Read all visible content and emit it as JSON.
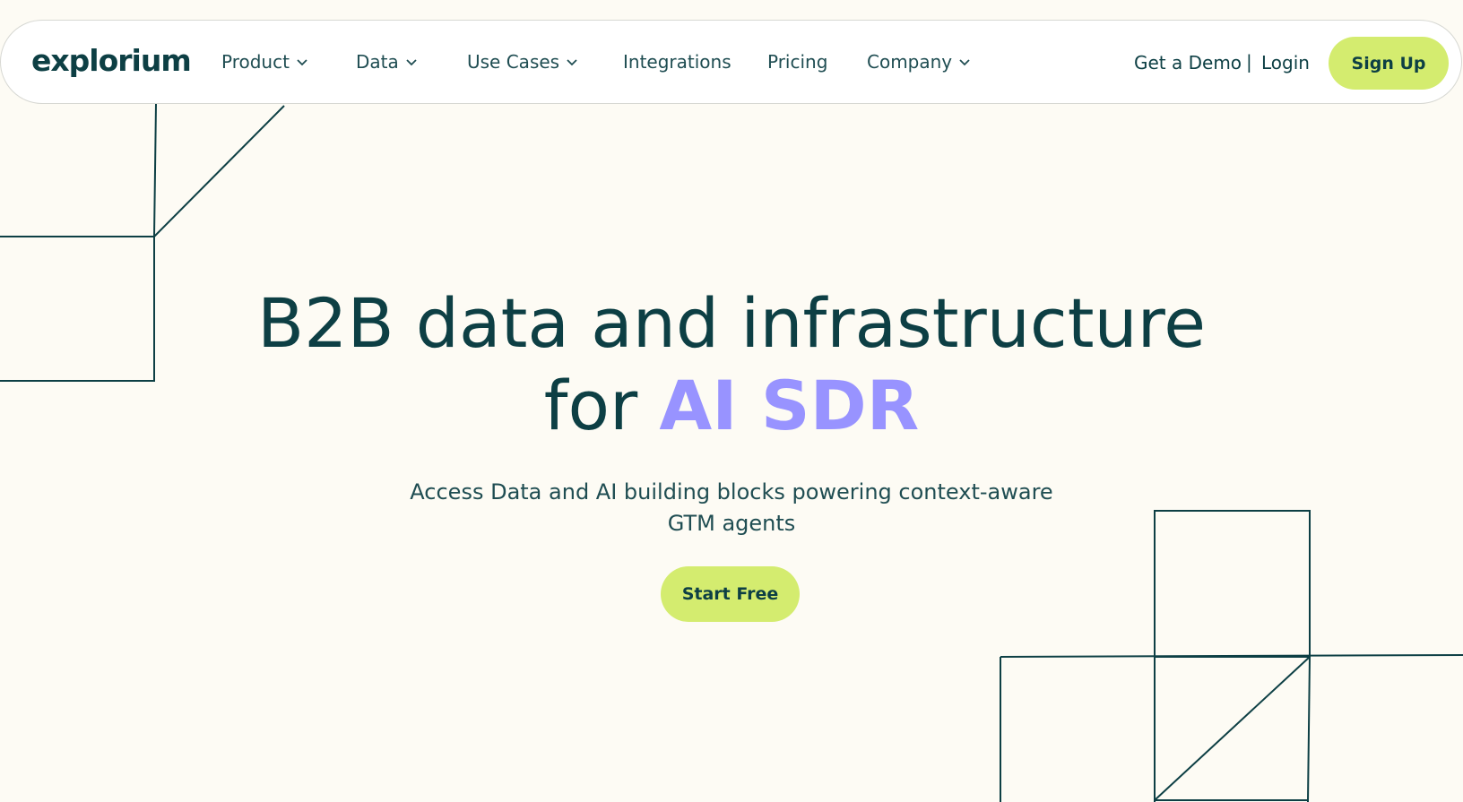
{
  "brand": {
    "logo_text": "explorium",
    "accent_color": "#d4ec6f",
    "highlight_color": "#9893ff",
    "text_color": "#0d3f44",
    "background_color": "#fdfbf4"
  },
  "nav": {
    "items": [
      {
        "label": "Product",
        "has_dropdown": true,
        "icon": "chevron-down-icon"
      },
      {
        "label": "Data",
        "has_dropdown": true,
        "icon": "chevron-down-icon"
      },
      {
        "label": "Use Cases",
        "has_dropdown": true,
        "icon": "chevron-down-icon"
      },
      {
        "label": "Integrations",
        "has_dropdown": false
      },
      {
        "label": "Pricing",
        "has_dropdown": false
      },
      {
        "label": "Company",
        "has_dropdown": true,
        "icon": "chevron-down-icon"
      }
    ],
    "get_demo_label": "Get a Demo",
    "separator": "|",
    "login_label": "Login",
    "signup_label": "Sign Up"
  },
  "hero": {
    "title_line1": "B2B data and infrastructure",
    "title_line2_prefix": "for ",
    "title_line2_highlight": "AI SDR",
    "subtitle_line1": "Access Data and AI building blocks powering context-aware",
    "subtitle_line2": "GTM agents",
    "cta_label": "Start Free"
  }
}
